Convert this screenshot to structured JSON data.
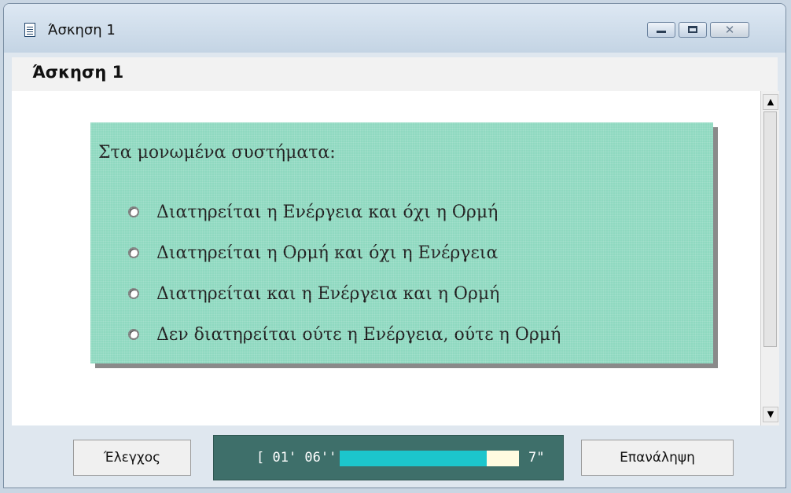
{
  "window": {
    "title": "Άσκηση 1",
    "close_glyph": "✕"
  },
  "header": {
    "title": "Άσκηση 1"
  },
  "question": {
    "text": "Στα μονωμένα συστήματα:",
    "options": [
      {
        "label": "Διατηρείται η Ενέργεια και όχι η Ορμή",
        "selected": false
      },
      {
        "label": "Διατηρείται η Ορμή και όχι η Ενέργεια",
        "selected": false
      },
      {
        "label": "Διατηρείται και η Ενέργεια και η Ορμή",
        "selected": false
      },
      {
        "label": "Δεν διατηρείται ούτε η Ενέργεια, ούτε η Ορμή",
        "selected": false
      }
    ]
  },
  "footer": {
    "check_label": "Έλεγχος",
    "retry_label": "Επανάληψη",
    "timer": {
      "elapsed": "[ 01' 06'' ]",
      "remaining": "7\"",
      "progress_fraction": 0.82
    }
  },
  "icons": {
    "window_icon": "document-icon",
    "minimize": "minimize-icon",
    "maximize": "maximize-icon",
    "close": "close-icon",
    "scroll_up": "arrow-up-icon",
    "scroll_down": "arrow-down-icon"
  },
  "colors": {
    "panel": "#8fd9c0",
    "timer_bg": "#3e6f6a",
    "timer_fill": "#1cc6cc",
    "timer_track": "#fffbe0"
  }
}
